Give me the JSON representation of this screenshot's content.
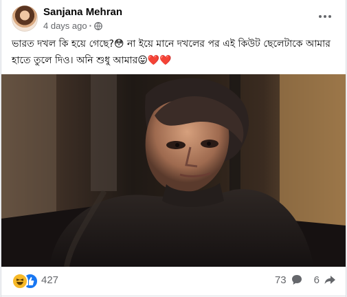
{
  "post": {
    "author": "Sanjana Mehran",
    "timestamp": "4 days ago",
    "separator": "·",
    "audience_icon": "globe-icon",
    "caption": "ভারত দখল কি হয়ে গেছে?😳 না ইয়ে মানে দখলের পর এই কিউট ছেলেটাকে আমার হাতে তুলে দিও। অনি শুধু আমার😛❤️❤️",
    "photo_description": "Portrait of a man with tousled dark hair wearing a dark sweater"
  },
  "reactions": {
    "types": [
      "haha",
      "like"
    ],
    "count": "427"
  },
  "stats": {
    "comments": "73",
    "shares": "6"
  },
  "colors": {
    "brand_blue": "#1877f2",
    "haha_yellow": "#f7b928",
    "secondary_text": "#65676b"
  }
}
